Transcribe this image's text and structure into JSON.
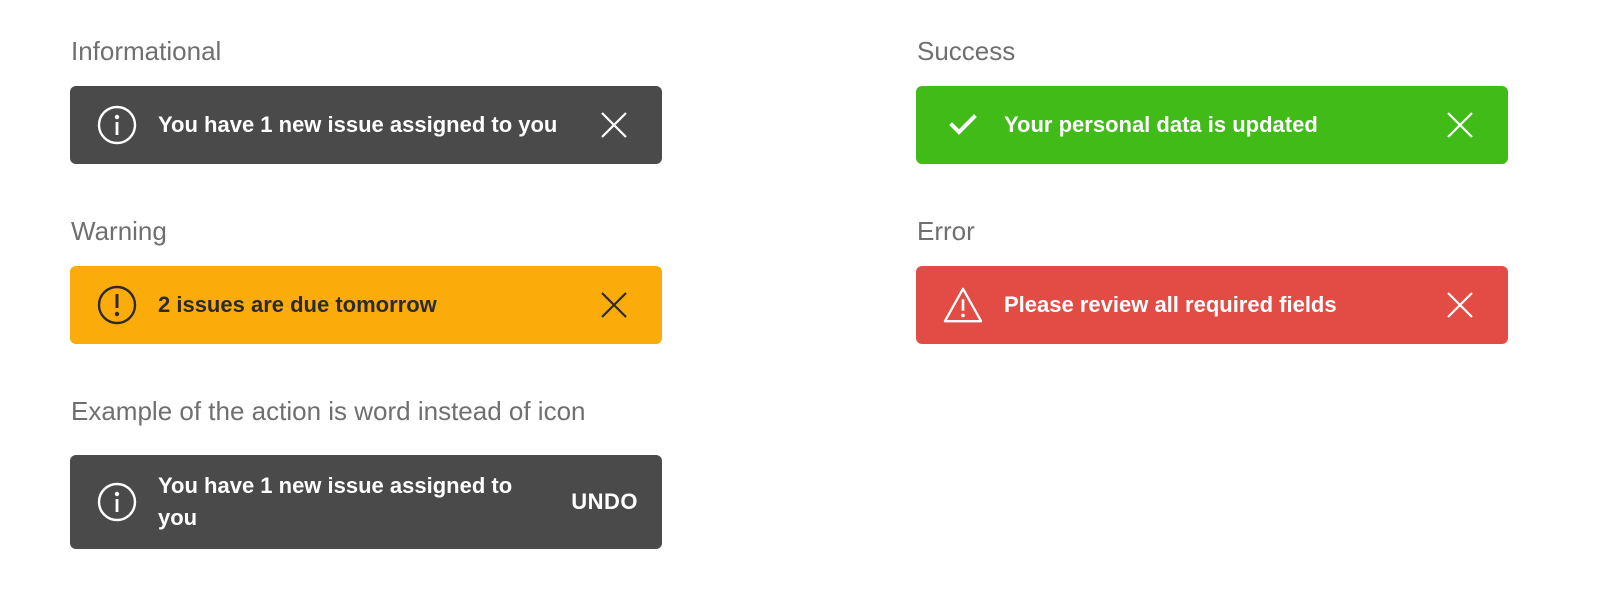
{
  "colors": {
    "informational": "#4a4a4a",
    "success": "#40bb18",
    "warning": "#fcac0a",
    "error": "#e34c45",
    "section_title": "#6f6f6f"
  },
  "sections": {
    "informational": {
      "title": "Informational",
      "message": "You have 1 new issue assigned to you",
      "icon": "info-circle-icon",
      "action": "close-icon"
    },
    "success": {
      "title": "Success",
      "message": "Your personal data is updated",
      "icon": "checkmark-icon",
      "action": "close-icon"
    },
    "warning": {
      "title": "Warning",
      "message": "2 issues are due tomorrow",
      "icon": "exclamation-circle-icon",
      "action": "close-icon"
    },
    "error": {
      "title": "Error",
      "message": "Please review all required fields",
      "icon": "warning-triangle-icon",
      "action": "close-icon"
    },
    "word_action": {
      "title": "Example of the action is word instead of icon",
      "message": "You have 1 new issue assigned to you",
      "icon": "info-circle-icon",
      "action_label": "UNDO"
    }
  }
}
